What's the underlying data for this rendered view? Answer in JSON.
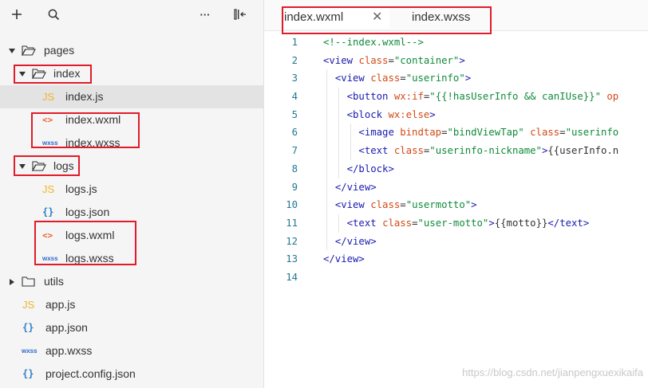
{
  "toolbar": {
    "add_icon": "plus-icon",
    "search_icon": "search-icon",
    "more_label": "···",
    "layout_icon": "collapse-panel-icon"
  },
  "tree": {
    "pages": "pages",
    "index_folder": "index",
    "index_js": "index.js",
    "index_wxml": "index.wxml",
    "index_wxss": "index.wxss",
    "logs_folder": "logs",
    "logs_js": "logs.js",
    "logs_json": "logs.json",
    "logs_wxml": "logs.wxml",
    "logs_wxss": "logs.wxss",
    "utils": "utils",
    "app_js": "app.js",
    "app_json": "app.json",
    "app_wxss": "app.wxss",
    "project_config": "project.config.json"
  },
  "file_icons": {
    "js": "JS",
    "wxml": "<>",
    "json": "{}",
    "wxss": "wxss"
  },
  "tabs": [
    {
      "label": "index.wxml",
      "active": true,
      "close": "✕"
    },
    {
      "label": "index.wxss",
      "active": false
    }
  ],
  "code": {
    "line_numbers": [
      "1",
      "2",
      "3",
      "4",
      "5",
      "6",
      "7",
      "8",
      "9",
      "10",
      "11",
      "12",
      "13",
      "14"
    ],
    "lines": [
      "<!--index.wxml-->",
      "<view class=\"container\">",
      "  <view class=\"userinfo\">",
      "    <button wx:if=\"{{!hasUserInfo && canIUse}}\" op",
      "    <block wx:else>",
      "      <image bindtap=\"bindViewTap\" class=\"userinfo",
      "      <text class=\"userinfo-nickname\">{{userInfo.n",
      "    </block>",
      "  </view>",
      "  <view class=\"usermotto\">",
      "    <text class=\"user-motto\">{{motto}}</text>",
      "  </view>",
      "</view>",
      ""
    ]
  },
  "watermark": "https://blog.csdn.net/jianpengxuexikaifa",
  "colors": {
    "highlight_box": "#e01c2a",
    "selected_row": "#e3e3e3",
    "tag": "#1a1ab0",
    "attr": "#d24a15",
    "string": "#108a3a"
  }
}
